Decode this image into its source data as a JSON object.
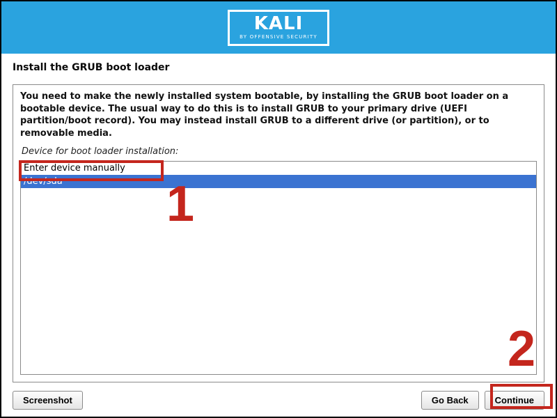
{
  "brand": {
    "title": "KALI",
    "subtitle": "BY OFFENSIVE SECURITY"
  },
  "page": {
    "title": "Install the GRUB boot loader",
    "instructions": "You need to make the newly installed system bootable, by installing the GRUB boot loader on a bootable device. The usual way to do this is to install GRUB to your primary drive (UEFI partition/boot record). You may instead install GRUB to a different drive (or partition), or to removable media.",
    "field_label": "Device for boot loader installation:"
  },
  "device_list": {
    "items": [
      {
        "label": "Enter device manually",
        "selected": false
      },
      {
        "label": "/dev/sda",
        "selected": true
      }
    ]
  },
  "buttons": {
    "screenshot": "Screenshot",
    "go_back": "Go Back",
    "continue": "Continue"
  },
  "annotations": {
    "one": "1",
    "two": "2"
  },
  "colors": {
    "accent": "#2aa3df",
    "selection": "#3b73d1",
    "annotation": "#c4261d"
  }
}
